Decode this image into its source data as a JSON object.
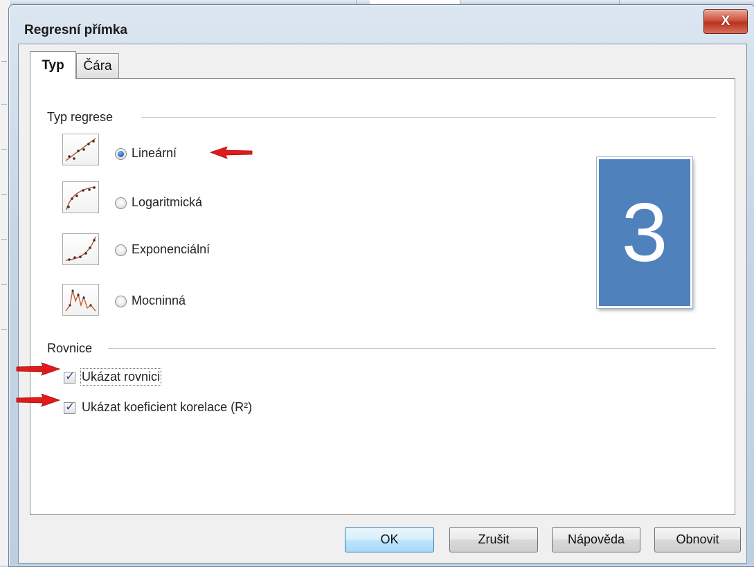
{
  "window": {
    "title": "Regresní přímka",
    "close_label": "X"
  },
  "tabs": [
    {
      "label": "Typ",
      "active": true
    },
    {
      "label": "Čára",
      "active": false
    }
  ],
  "regression": {
    "section_label": "Typ regrese",
    "options": [
      {
        "label": "Lineární",
        "icon": "linear-regression-icon",
        "selected": true
      },
      {
        "label": "Logaritmická",
        "icon": "logarithmic-regression-icon",
        "selected": false
      },
      {
        "label": "Exponenciální",
        "icon": "exponential-regression-icon",
        "selected": false
      },
      {
        "label": "Mocninná",
        "icon": "power-regression-icon",
        "selected": false
      }
    ]
  },
  "equation": {
    "section_label": "Rovnice",
    "show_equation": {
      "label": "Ukázat rovnici",
      "checked": true
    },
    "show_r2": {
      "label": "Ukázat koeficient korelace (R²)",
      "checked": true
    }
  },
  "step_badge": "3",
  "buttons": {
    "ok": "OK",
    "cancel": "Zrušit",
    "help": "Nápověda",
    "reset": "Obnovit"
  },
  "colors": {
    "badge": "#4f81bd",
    "arrow": "#e21a1a",
    "close": "#c9402a"
  }
}
